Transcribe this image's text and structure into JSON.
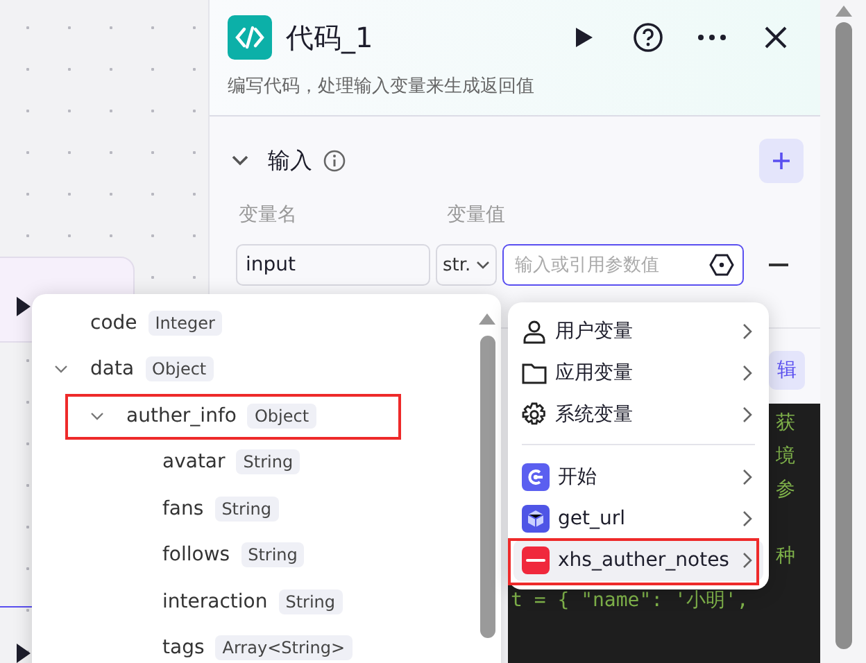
{
  "panel": {
    "title": "代码_1",
    "description": "编写代码，处理输入变量来生成返回值"
  },
  "input_section": {
    "title": "输入",
    "expanded": true,
    "columns": [
      "变量名",
      "变量值"
    ],
    "rows": [
      {
        "name": "input",
        "type": "str.",
        "placeholder": "输入或引用参数值"
      }
    ]
  },
  "edit_button": "辑",
  "code_lines": [
    {
      "text": "获",
      "kind": "fragment"
    },
    {
      "text": "境",
      "kind": "fragment"
    },
    {
      "text": "参",
      "kind": "fragment"
    },
    {
      "kind": "blank"
    },
    {
      "text": "种",
      "kind": "fragment"
    },
    {
      "text": "t = { \"name\": '小明',",
      "kind": "line"
    }
  ],
  "tree": [
    {
      "name": "code",
      "type": "Integer"
    },
    {
      "name": "data",
      "type": "Object",
      "expanded": true,
      "children": [
        {
          "name": "auther_info",
          "type": "Object",
          "expanded": true,
          "highlighted": true,
          "children": [
            {
              "name": "avatar",
              "type": "String"
            },
            {
              "name": "fans",
              "type": "String"
            },
            {
              "name": "follows",
              "type": "String"
            },
            {
              "name": "interaction",
              "type": "String"
            },
            {
              "name": "tags",
              "type": "Array<String>"
            }
          ]
        }
      ]
    }
  ],
  "variable_menu": [
    {
      "label": "用户变量",
      "kind": "user",
      "highlighted": false
    },
    {
      "label": "应用变量",
      "kind": "folder",
      "highlighted": false
    },
    {
      "label": "系统变量",
      "kind": "system",
      "highlighted": false
    },
    {
      "label": "开始",
      "kind": "start",
      "highlighted": false
    },
    {
      "label": "get_url",
      "kind": "plugin",
      "highlighted": false
    },
    {
      "label": "xhs_auther_notes",
      "kind": "xhs",
      "highlighted": true
    }
  ]
}
